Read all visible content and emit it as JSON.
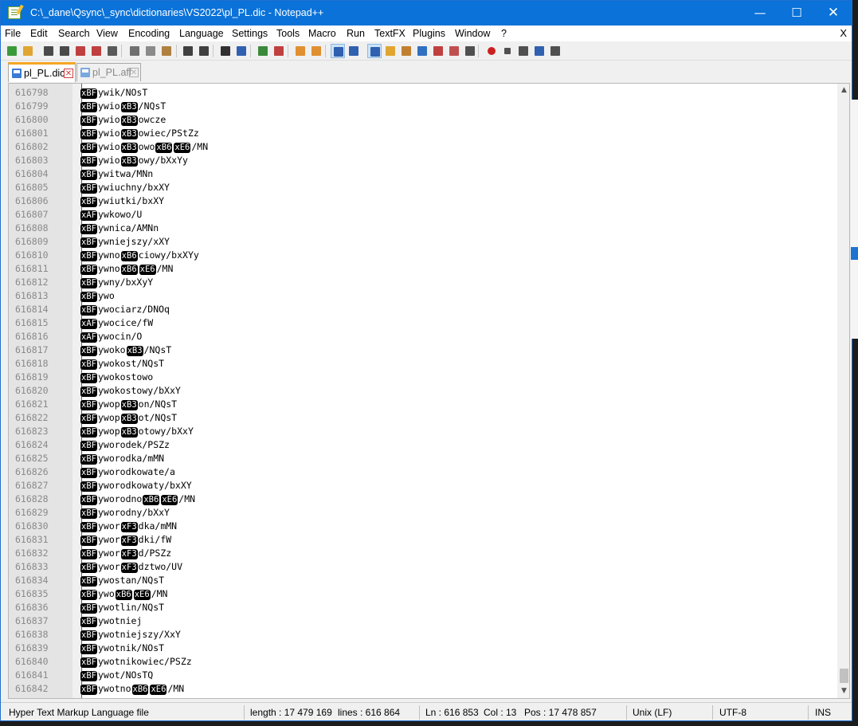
{
  "window": {
    "title": "C:\\_dane\\Qsync\\_sync\\dictionaries\\VS2022\\pl_PL.dic - Notepad++",
    "minimize_glyph": "—",
    "maximize_glyph": "☐",
    "close_glyph": "✕"
  },
  "menu": {
    "items": [
      "File",
      "Edit",
      "Search",
      "View",
      "Encoding",
      "Language",
      "Settings",
      "Tools",
      "Macro",
      "Run",
      "TextFX",
      "Plugins",
      "Window",
      "?"
    ],
    "close_label": "X"
  },
  "toolbar": {
    "buttons": [
      {
        "name": "new-file-icon",
        "color": "#3a9a3a"
      },
      {
        "name": "open-file-icon",
        "color": "#e0a530"
      },
      {
        "name": "save-icon",
        "color": "#4a4a4a"
      },
      {
        "name": "save-all-icon",
        "color": "#4a4a4a"
      },
      {
        "name": "close-file-icon",
        "color": "#c04040"
      },
      {
        "name": "close-all-icon",
        "color": "#c04040"
      },
      {
        "name": "print-icon",
        "color": "#5a5a5a"
      },
      {
        "name": "cut-icon",
        "color": "#707070"
      },
      {
        "name": "copy-icon",
        "color": "#8a8a8a"
      },
      {
        "name": "paste-icon",
        "color": "#b08040"
      },
      {
        "name": "undo-icon",
        "color": "#404040"
      },
      {
        "name": "redo-icon",
        "color": "#404040"
      },
      {
        "name": "find-icon",
        "color": "#303030"
      },
      {
        "name": "replace-icon",
        "color": "#3060b0"
      },
      {
        "name": "zoom-in-icon",
        "color": "#3a8a3a"
      },
      {
        "name": "zoom-out-icon",
        "color": "#c04040"
      },
      {
        "name": "sync-vertical-icon",
        "color": "#e09030"
      },
      {
        "name": "sync-horizontal-icon",
        "color": "#e09030"
      },
      {
        "name": "word-wrap-icon",
        "color": "#3060b0"
      },
      {
        "name": "show-all-chars-icon",
        "color": "#3060b0"
      },
      {
        "name": "indent-guide-icon",
        "color": "#3060b0"
      },
      {
        "name": "udl-icon",
        "color": "#e0a530"
      },
      {
        "name": "doc-map-icon",
        "color": "#c08030"
      },
      {
        "name": "function-list-icon",
        "color": "#3070c0"
      },
      {
        "name": "folder-as-workspace-icon",
        "color": "#c04040"
      },
      {
        "name": "folder-icon",
        "color": "#c05050"
      },
      {
        "name": "monitor-icon",
        "color": "#505050"
      },
      {
        "name": "record-macro-icon",
        "color": "#cc2020"
      },
      {
        "name": "stop-macro-icon",
        "color": "#505050"
      },
      {
        "name": "play-macro-icon",
        "color": "#505050"
      },
      {
        "name": "run-macro-multiple-icon",
        "color": "#3060b0"
      },
      {
        "name": "save-macro-icon",
        "color": "#505050"
      }
    ]
  },
  "tabs": [
    {
      "label": "pl_PL.dic",
      "close": "✕"
    },
    {
      "label": "pl_PL.aff",
      "close": "✕"
    }
  ],
  "editor": {
    "lines": [
      {
        "n": "616798",
        "parts": [
          {
            "c": "xBF"
          },
          {
            "t": "ywik/NOsT"
          }
        ]
      },
      {
        "n": "616799",
        "parts": [
          {
            "c": "xBF"
          },
          {
            "t": "ywio"
          },
          {
            "c": "xB3"
          },
          {
            "t": "/NQsT"
          }
        ]
      },
      {
        "n": "616800",
        "parts": [
          {
            "c": "xBF"
          },
          {
            "t": "ywio"
          },
          {
            "c": "xB3"
          },
          {
            "t": "owcze"
          }
        ]
      },
      {
        "n": "616801",
        "parts": [
          {
            "c": "xBF"
          },
          {
            "t": "ywio"
          },
          {
            "c": "xB3"
          },
          {
            "t": "owiec/PStZz"
          }
        ]
      },
      {
        "n": "616802",
        "parts": [
          {
            "c": "xBF"
          },
          {
            "t": "ywio"
          },
          {
            "c": "xB3"
          },
          {
            "t": "owo"
          },
          {
            "c": "xB6"
          },
          {
            "c": "xE6"
          },
          {
            "t": "/MN"
          }
        ]
      },
      {
        "n": "616803",
        "parts": [
          {
            "c": "xBF"
          },
          {
            "t": "ywio"
          },
          {
            "c": "xB3"
          },
          {
            "t": "owy/bXxYy"
          }
        ]
      },
      {
        "n": "616804",
        "parts": [
          {
            "c": "xBF"
          },
          {
            "t": "ywitwa/MNn"
          }
        ]
      },
      {
        "n": "616805",
        "parts": [
          {
            "c": "xBF"
          },
          {
            "t": "ywiuchny/bxXY"
          }
        ]
      },
      {
        "n": "616806",
        "parts": [
          {
            "c": "xBF"
          },
          {
            "t": "ywiutki/bxXY"
          }
        ]
      },
      {
        "n": "616807",
        "parts": [
          {
            "c": "xAF"
          },
          {
            "t": "ywkowo/U"
          }
        ]
      },
      {
        "n": "616808",
        "parts": [
          {
            "c": "xBF"
          },
          {
            "t": "ywnica/AMNn"
          }
        ]
      },
      {
        "n": "616809",
        "parts": [
          {
            "c": "xBF"
          },
          {
            "t": "ywniejszy/xXY"
          }
        ]
      },
      {
        "n": "616810",
        "parts": [
          {
            "c": "xBF"
          },
          {
            "t": "ywno"
          },
          {
            "c": "xB6"
          },
          {
            "t": "ciowy/bxXYy"
          }
        ]
      },
      {
        "n": "616811",
        "parts": [
          {
            "c": "xBF"
          },
          {
            "t": "ywno"
          },
          {
            "c": "xB6"
          },
          {
            "c": "xE6"
          },
          {
            "t": "/MN"
          }
        ]
      },
      {
        "n": "616812",
        "parts": [
          {
            "c": "xBF"
          },
          {
            "t": "ywny/bxXyY"
          }
        ]
      },
      {
        "n": "616813",
        "parts": [
          {
            "c": "xBF"
          },
          {
            "t": "ywo"
          }
        ]
      },
      {
        "n": "616814",
        "parts": [
          {
            "c": "xBF"
          },
          {
            "t": "ywociarz/DNOq"
          }
        ]
      },
      {
        "n": "616815",
        "parts": [
          {
            "c": "xAF"
          },
          {
            "t": "ywocice/fW"
          }
        ]
      },
      {
        "n": "616816",
        "parts": [
          {
            "c": "xAF"
          },
          {
            "t": "ywocin/O"
          }
        ]
      },
      {
        "n": "616817",
        "parts": [
          {
            "c": "xBF"
          },
          {
            "t": "ywoko"
          },
          {
            "c": "xB3"
          },
          {
            "t": "/NQsT"
          }
        ]
      },
      {
        "n": "616818",
        "parts": [
          {
            "c": "xBF"
          },
          {
            "t": "ywokost/NQsT"
          }
        ]
      },
      {
        "n": "616819",
        "parts": [
          {
            "c": "xBF"
          },
          {
            "t": "ywokostowo"
          }
        ]
      },
      {
        "n": "616820",
        "parts": [
          {
            "c": "xBF"
          },
          {
            "t": "ywokostowy/bXxY"
          }
        ]
      },
      {
        "n": "616821",
        "parts": [
          {
            "c": "xBF"
          },
          {
            "t": "ywop"
          },
          {
            "c": "xB3"
          },
          {
            "t": "on/NQsT"
          }
        ]
      },
      {
        "n": "616822",
        "parts": [
          {
            "c": "xBF"
          },
          {
            "t": "ywop"
          },
          {
            "c": "xB3"
          },
          {
            "t": "ot/NQsT"
          }
        ]
      },
      {
        "n": "616823",
        "parts": [
          {
            "c": "xBF"
          },
          {
            "t": "ywop"
          },
          {
            "c": "xB3"
          },
          {
            "t": "otowy/bXxY"
          }
        ]
      },
      {
        "n": "616824",
        "parts": [
          {
            "c": "xBF"
          },
          {
            "t": "yworodek/PSZz"
          }
        ]
      },
      {
        "n": "616825",
        "parts": [
          {
            "c": "xBF"
          },
          {
            "t": "yworodka/mMN"
          }
        ]
      },
      {
        "n": "616826",
        "parts": [
          {
            "c": "xBF"
          },
          {
            "t": "yworodkowate/a"
          }
        ]
      },
      {
        "n": "616827",
        "parts": [
          {
            "c": "xBF"
          },
          {
            "t": "yworodkowaty/bxXY"
          }
        ]
      },
      {
        "n": "616828",
        "parts": [
          {
            "c": "xBF"
          },
          {
            "t": "yworodno"
          },
          {
            "c": "xB6"
          },
          {
            "c": "xE6"
          },
          {
            "t": "/MN"
          }
        ]
      },
      {
        "n": "616829",
        "parts": [
          {
            "c": "xBF"
          },
          {
            "t": "yworodny/bXxY"
          }
        ]
      },
      {
        "n": "616830",
        "parts": [
          {
            "c": "xBF"
          },
          {
            "t": "ywor"
          },
          {
            "c": "xF3"
          },
          {
            "t": "dka/mMN"
          }
        ]
      },
      {
        "n": "616831",
        "parts": [
          {
            "c": "xBF"
          },
          {
            "t": "ywor"
          },
          {
            "c": "xF3"
          },
          {
            "t": "dki/fW"
          }
        ]
      },
      {
        "n": "616832",
        "parts": [
          {
            "c": "xBF"
          },
          {
            "t": "ywor"
          },
          {
            "c": "xF3"
          },
          {
            "t": "d/PSZz"
          }
        ]
      },
      {
        "n": "616833",
        "parts": [
          {
            "c": "xBF"
          },
          {
            "t": "ywor"
          },
          {
            "c": "xF3"
          },
          {
            "t": "dztwo/UV"
          }
        ]
      },
      {
        "n": "616834",
        "parts": [
          {
            "c": "xBF"
          },
          {
            "t": "ywostan/NQsT"
          }
        ]
      },
      {
        "n": "616835",
        "parts": [
          {
            "c": "xBF"
          },
          {
            "t": "ywo"
          },
          {
            "c": "xB6"
          },
          {
            "c": "xE6"
          },
          {
            "t": "/MN"
          }
        ]
      },
      {
        "n": "616836",
        "parts": [
          {
            "c": "xBF"
          },
          {
            "t": "ywotlin/NQsT"
          }
        ]
      },
      {
        "n": "616837",
        "parts": [
          {
            "c": "xBF"
          },
          {
            "t": "ywotniej"
          }
        ]
      },
      {
        "n": "616838",
        "parts": [
          {
            "c": "xBF"
          },
          {
            "t": "ywotniejszy/XxY"
          }
        ]
      },
      {
        "n": "616839",
        "parts": [
          {
            "c": "xBF"
          },
          {
            "t": "ywotnik/NOsT"
          }
        ]
      },
      {
        "n": "616840",
        "parts": [
          {
            "c": "xBF"
          },
          {
            "t": "ywotnikowiec/PSZz"
          }
        ]
      },
      {
        "n": "616841",
        "parts": [
          {
            "c": "xBF"
          },
          {
            "t": "ywot/NOsTQ"
          }
        ]
      },
      {
        "n": "616842",
        "parts": [
          {
            "c": "xBF"
          },
          {
            "t": "ywotno"
          },
          {
            "c": "xB6"
          },
          {
            "c": "xE6"
          },
          {
            "t": "/MN"
          }
        ]
      }
    ],
    "scroll": {
      "up": "▲",
      "down": "▼",
      "position": 0.995
    }
  },
  "status": {
    "language": "Hyper Text Markup Language file",
    "length": "length : 17 479 169",
    "lines": "lines : 616 864",
    "ln": "Ln : 616 853",
    "col": "Col : 13",
    "pos": "Pos : 17 478 857",
    "eol": "Unix (LF)",
    "encoding": "UTF-8",
    "mode": "INS"
  }
}
